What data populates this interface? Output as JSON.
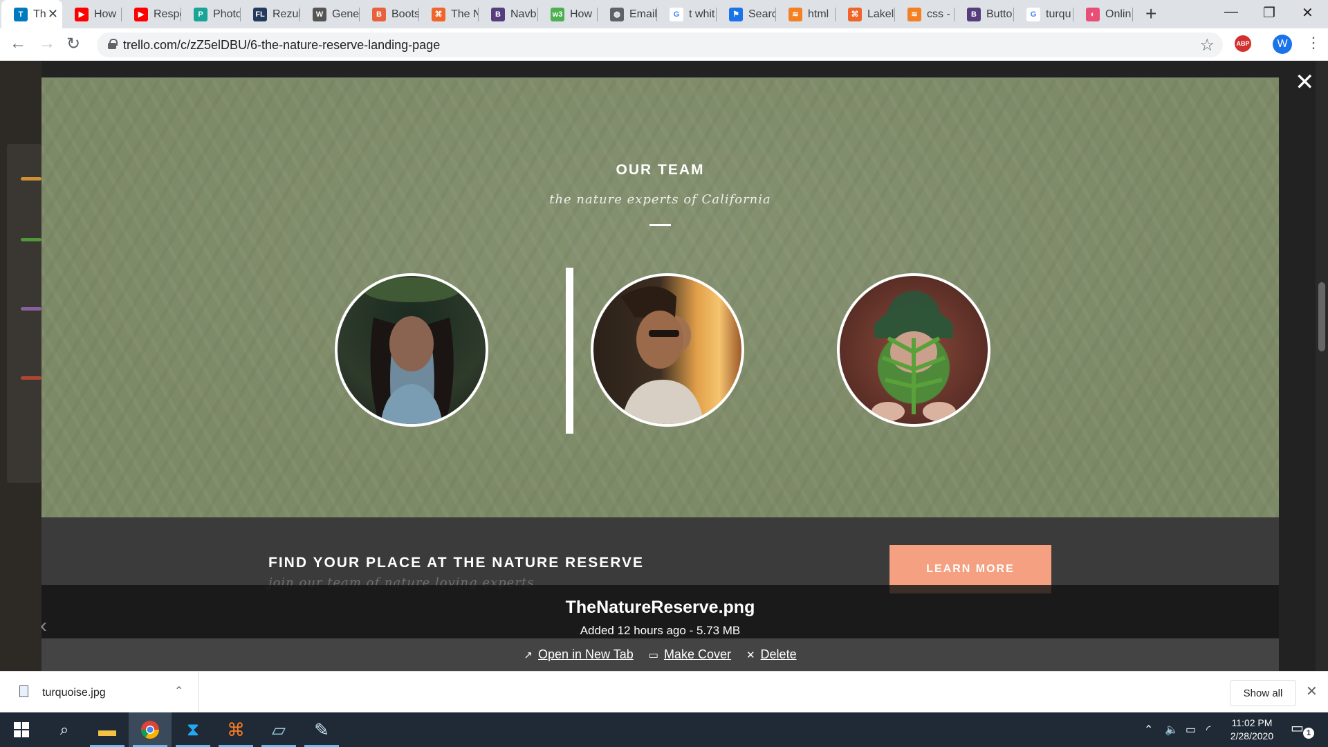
{
  "browser": {
    "tabs": [
      {
        "title": "Th",
        "favicon": "trello-icon",
        "fav_color": "#0079bf",
        "fav_glyph": "T"
      },
      {
        "title": "How",
        "favicon": "youtube-icon",
        "fav_color": "#ff0000",
        "fav_glyph": "▶"
      },
      {
        "title": "Respo",
        "favicon": "youtube-icon",
        "fav_color": "#ff0000",
        "fav_glyph": "▶"
      },
      {
        "title": "Photo",
        "favicon": "photopea-icon",
        "fav_color": "#18a497",
        "fav_glyph": "P"
      },
      {
        "title": "Rezul",
        "favicon": "fl-icon",
        "fav_color": "#243a5e",
        "fav_glyph": "FL"
      },
      {
        "title": "Gene",
        "favicon": "wordpress-icon",
        "fav_color": "#555555",
        "fav_glyph": "W"
      },
      {
        "title": "Boots",
        "favicon": "bootsnipp-icon",
        "fav_color": "#e8613c",
        "fav_glyph": "B"
      },
      {
        "title": "The N",
        "favicon": "codepen-icon",
        "fav_color": "#f0642a",
        "fav_glyph": "⌘"
      },
      {
        "title": "Navb",
        "favicon": "bootstrap-icon",
        "fav_color": "#563d7c",
        "fav_glyph": "B"
      },
      {
        "title": "How",
        "favicon": "w3schools-icon",
        "fav_color": "#4caf50",
        "fav_glyph": "w3"
      },
      {
        "title": "Email",
        "favicon": "globe-icon",
        "fav_color": "#5f6368",
        "fav_glyph": "◍"
      },
      {
        "title": "t whit",
        "favicon": "google-icon",
        "fav_color": "#ffffff",
        "fav_glyph": "G"
      },
      {
        "title": "Searc",
        "favicon": "flag-icon",
        "fav_color": "#1a73e8",
        "fav_glyph": "⚑"
      },
      {
        "title": "html",
        "favicon": "stackoverflow-icon",
        "fav_color": "#f48024",
        "fav_glyph": "≋"
      },
      {
        "title": "Lakel",
        "favicon": "codepen-icon",
        "fav_color": "#f0642a",
        "fav_glyph": "⌘"
      },
      {
        "title": "css -",
        "favicon": "stackoverflow-icon",
        "fav_color": "#f48024",
        "fav_glyph": "≋"
      },
      {
        "title": "Butto",
        "favicon": "bootstrap-icon",
        "fav_color": "#563d7c",
        "fav_glyph": "B"
      },
      {
        "title": "turqu",
        "favicon": "google-icon",
        "fav_color": "#ffffff",
        "fav_glyph": "G"
      },
      {
        "title": "Onlin",
        "favicon": "color-wheel-icon",
        "fav_color": "#e94e77",
        "fav_glyph": "◐"
      }
    ],
    "url": "trello.com/c/zZ5elDBU/6-the-nature-reserve-landing-page",
    "profile_initial": "W",
    "adblock_label": "ABP"
  },
  "preview": {
    "team_title": "OUR TEAM",
    "team_subtitle": "the nature experts of California",
    "cta_title": "FIND YOUR PLACE AT THE NATURE RESERVE",
    "cta_subtitle": "join our team of nature loving experts",
    "cta_button": "LEARN MORE",
    "accent_color": "#f5a081",
    "section_color": "#7d8a67"
  },
  "attachment": {
    "file_name": "TheNatureReserve.png",
    "meta": "Added 12 hours ago - 5.73 MB",
    "actions": {
      "open": "Open in New Tab",
      "cover": "Make Cover",
      "delete": "Delete"
    }
  },
  "downloads": {
    "file": "turquoise.jpg",
    "show_all": "Show all"
  },
  "taskbar": {
    "time": "11:02 PM",
    "date": "2/28/2020",
    "notifications": "1"
  }
}
